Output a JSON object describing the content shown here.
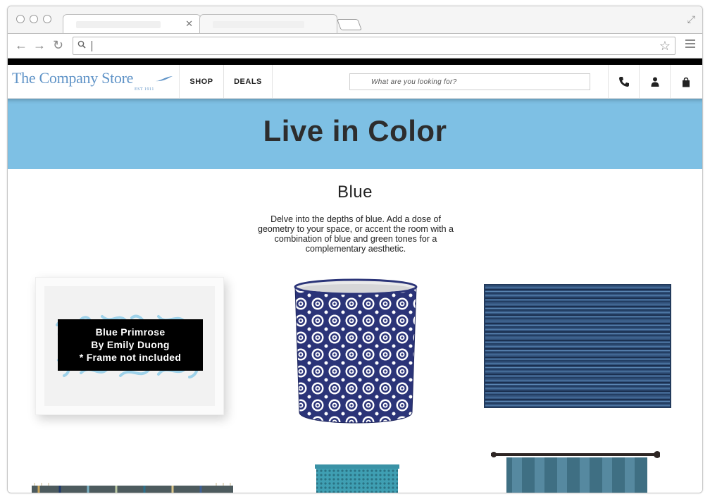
{
  "browser": {
    "tabs": [
      {
        "label": ""
      },
      {
        "label": ""
      }
    ],
    "omnibox_value": ""
  },
  "site": {
    "logo_text": "The Company Store",
    "logo_est": "EST 1911",
    "nav": [
      {
        "label": "SHOP"
      },
      {
        "label": "DEALS"
      }
    ],
    "search_placeholder": "What are you looking for?",
    "brand_color": "#5f93c7"
  },
  "hero": {
    "title": "Live in Color",
    "background": "#7ec0e4"
  },
  "section": {
    "title": "Blue",
    "description": "Delve into the depths of blue. Add a dose of geometry to your space, or accent the room with a combination of blue and green tones for a complementary aesthetic."
  },
  "products": {
    "tooltip": {
      "line1": "Blue Primrose",
      "line2": "By Emily Duong",
      "line3": "* Frame not included"
    }
  }
}
